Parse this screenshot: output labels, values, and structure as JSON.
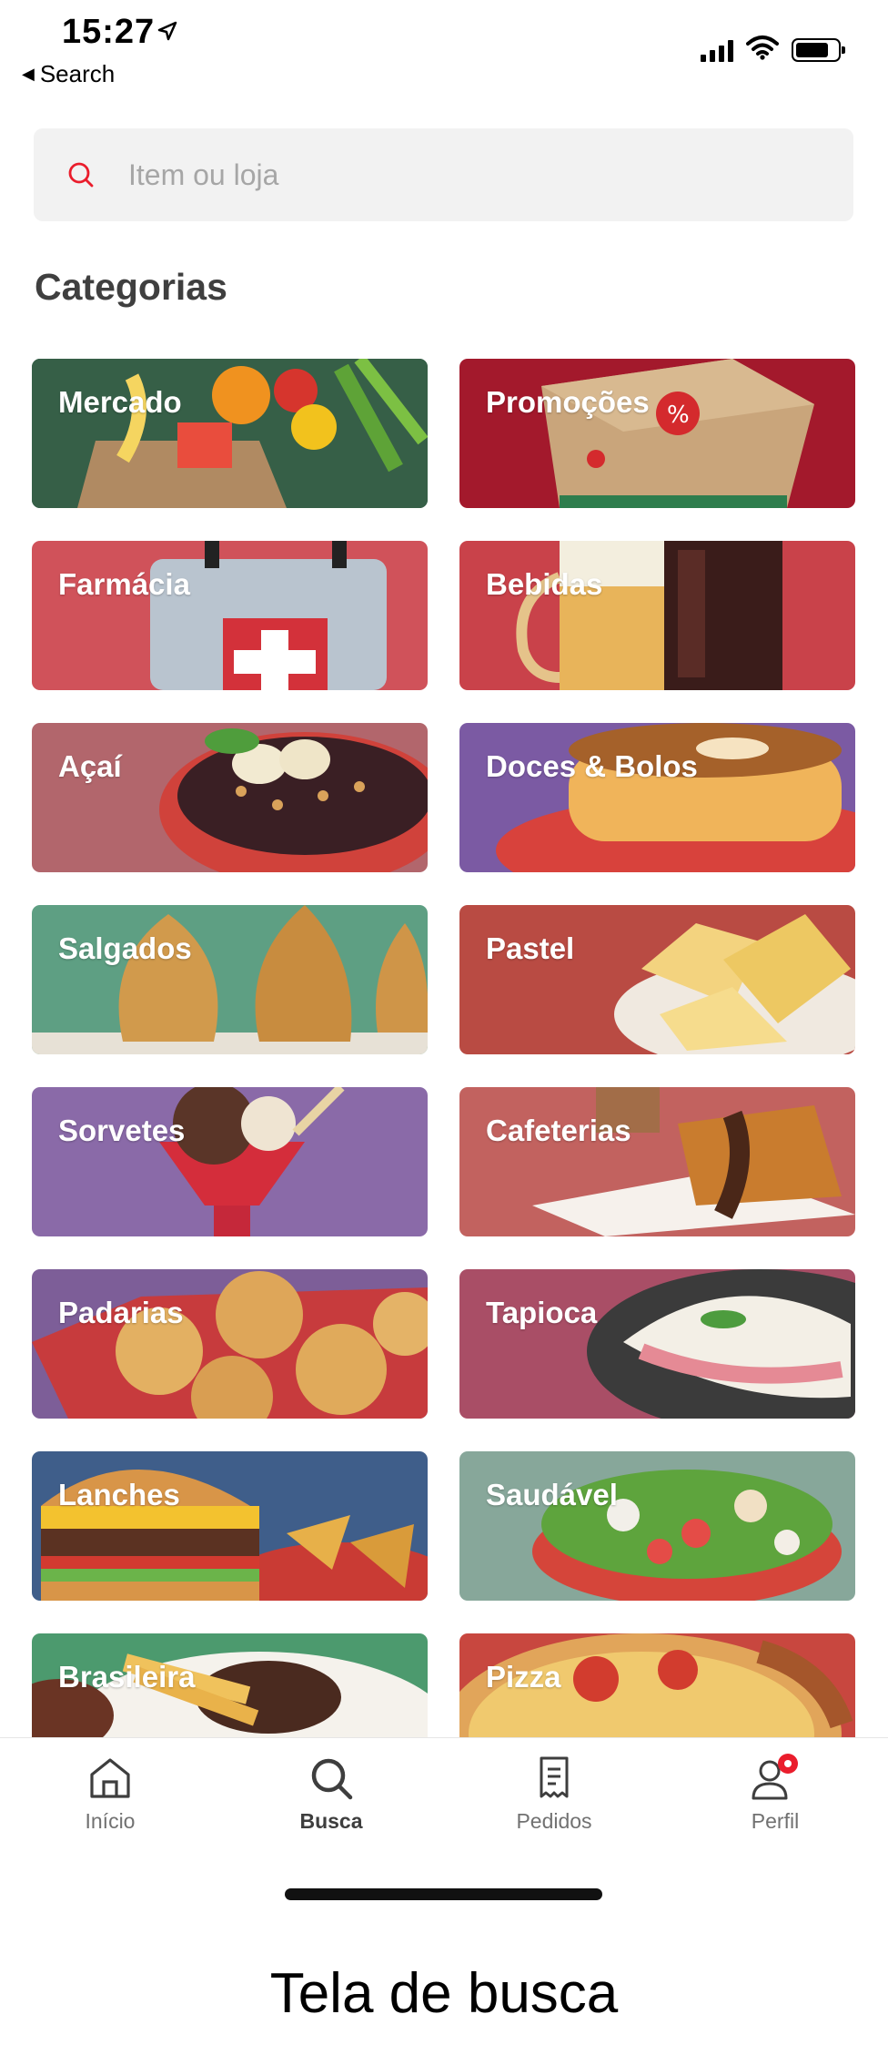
{
  "status_bar": {
    "time": "15:27",
    "back_label": "Search"
  },
  "search": {
    "placeholder": "Item ou loja"
  },
  "section_title": "Categorias",
  "categories": [
    {
      "label": "Mercado"
    },
    {
      "label": "Promoções"
    },
    {
      "label": "Farmácia"
    },
    {
      "label": "Bebidas"
    },
    {
      "label": "Açaí"
    },
    {
      "label": "Doces & Bolos"
    },
    {
      "label": "Salgados"
    },
    {
      "label": "Pastel"
    },
    {
      "label": "Sorvetes"
    },
    {
      "label": "Cafeterias"
    },
    {
      "label": "Padarias"
    },
    {
      "label": "Tapioca"
    },
    {
      "label": "Lanches"
    },
    {
      "label": "Saudável"
    },
    {
      "label": "Brasileira"
    },
    {
      "label": "Pizza"
    }
  ],
  "tabbar": {
    "items": [
      {
        "label": "Início",
        "icon": "home-icon"
      },
      {
        "label": "Busca",
        "icon": "search-icon",
        "active": true
      },
      {
        "label": "Pedidos",
        "icon": "receipt-icon"
      },
      {
        "label": "Perfil",
        "icon": "profile-icon",
        "notification": true
      }
    ]
  },
  "caption": "Tela de busca",
  "colors": {
    "accent": "#ea1d2c",
    "search_bg": "#f2f2f2"
  }
}
